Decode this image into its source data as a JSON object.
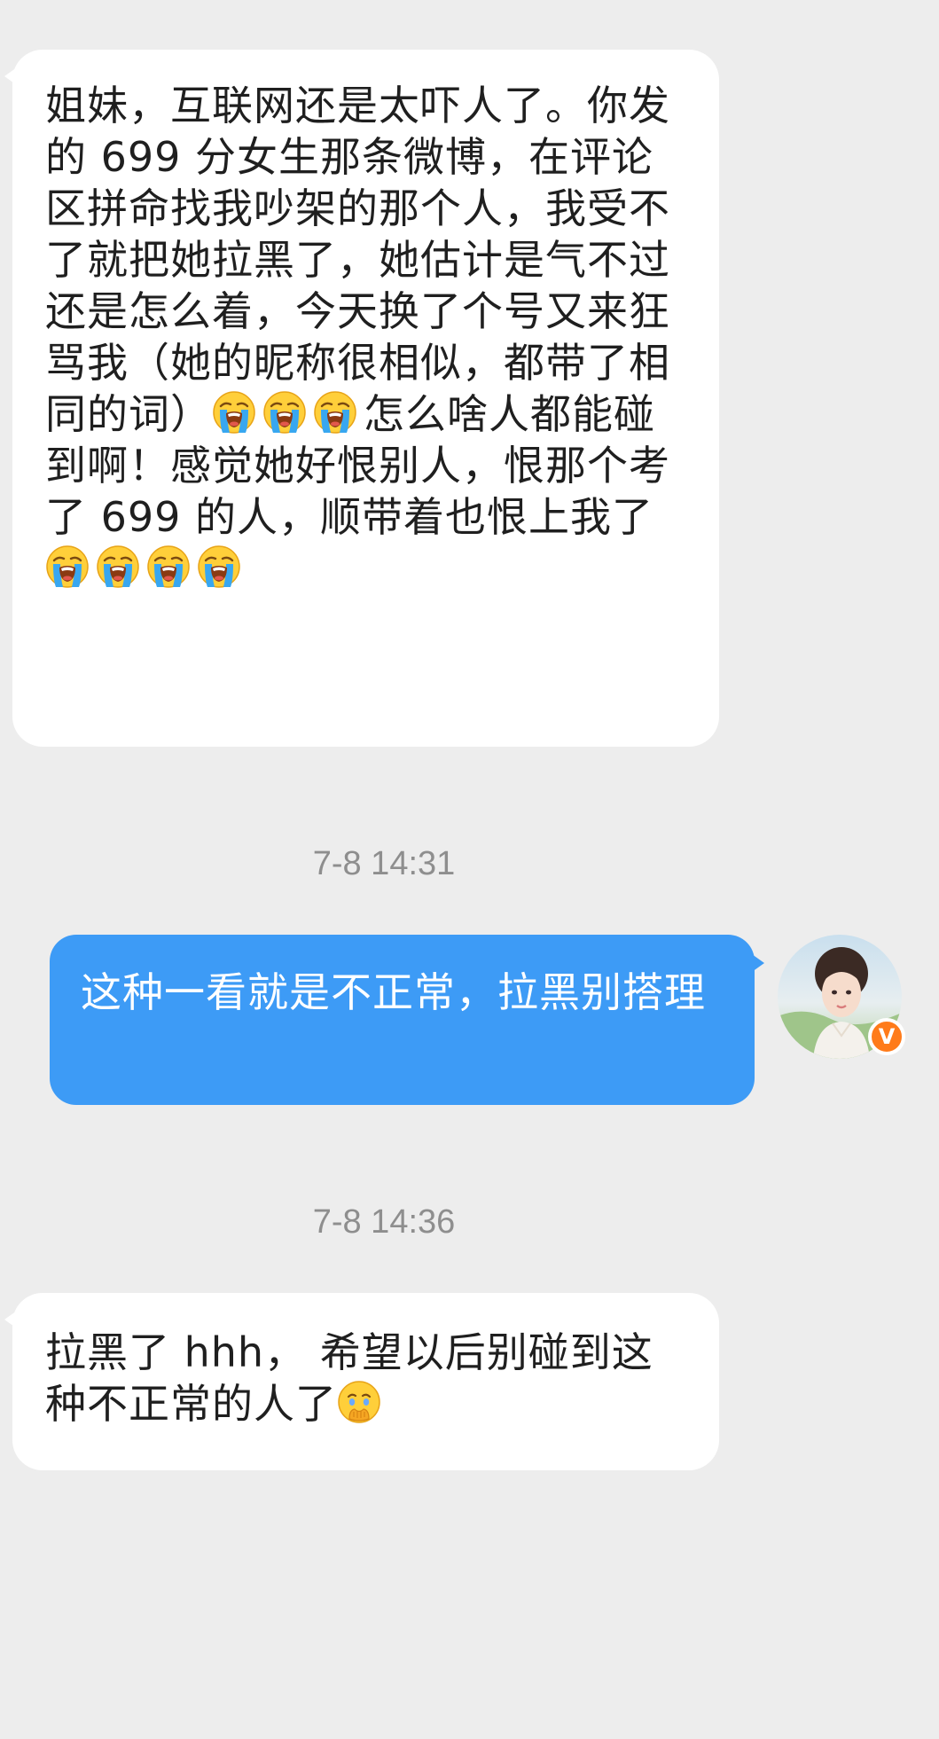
{
  "conversation": {
    "messages": [
      {
        "sender": "other",
        "segments": [
          {
            "t": "text",
            "v": "姐妹，互联网还是太吓人了。你发的 699 分女生那条微博，在评论区拼命找我吵架的那个人，我受不了就把她拉黑了，她估计是气不过还是怎么着，今天换了个号又来狂骂我（她的昵称很相似，都带了相同的词）"
          },
          {
            "t": "emoji",
            "v": "loudly-crying-emoji"
          },
          {
            "t": "emoji",
            "v": "loudly-crying-emoji"
          },
          {
            "t": "emoji",
            "v": "loudly-crying-emoji"
          },
          {
            "t": "text",
            "v": "怎么啥人都能碰到啊！感觉她好恨别人，恨那个考了 699 的人，顺带着也恨上我了"
          },
          {
            "t": "emoji",
            "v": "loudly-crying-emoji"
          },
          {
            "t": "emoji",
            "v": "loudly-crying-emoji"
          },
          {
            "t": "emoji",
            "v": "loudly-crying-emoji"
          },
          {
            "t": "emoji",
            "v": "loudly-crying-emoji"
          }
        ]
      },
      {
        "timestamp": "7-8 14:31"
      },
      {
        "sender": "self",
        "segments": [
          {
            "t": "text",
            "v": "这种一看就是不正常，拉黑别搭理"
          }
        ]
      },
      {
        "timestamp": "7-8 14:36"
      },
      {
        "sender": "other",
        "segments": [
          {
            "t": "text",
            "v": "拉黑了 hhh， 希望以后别碰到这种不正常的人了"
          },
          {
            "t": "emoji",
            "v": "holding-back-tears-emoji"
          }
        ]
      }
    ],
    "self_avatar": {
      "icon": "user-avatar",
      "badge": "V",
      "badge_color": "#ff7b1a"
    }
  },
  "colors": {
    "background": "#ededed",
    "incoming_bubble": "#ffffff",
    "outgoing_bubble": "#3d9bf6",
    "timestamp_text": "#8e8e8e"
  }
}
